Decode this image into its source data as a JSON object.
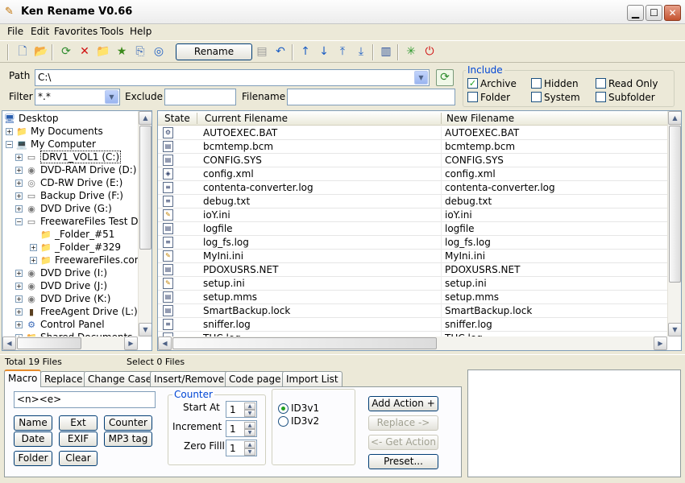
{
  "window": {
    "title": "Ken Rename V0.66",
    "icon": "pencil-icon"
  },
  "menu": [
    "File",
    "Edit",
    "Favorites",
    "Tools",
    "Help"
  ],
  "toolbar": {
    "rename_label": "Rename",
    "icons": [
      "new-icon",
      "open-folder-icon",
      "refresh-icon",
      "delete-icon",
      "folder-icon",
      "favorites-star-icon",
      "copy-icon",
      "stop-icon",
      "rename-icon",
      "properties-icon",
      "undo-icon",
      "move-up-icon",
      "move-down-icon",
      "move-top-icon",
      "move-bottom-icon",
      "options-icon",
      "grid-icon",
      "power-icon"
    ]
  },
  "path": {
    "label": "Path",
    "value": "C:\\"
  },
  "filter": {
    "label": "Filter",
    "value": "*.*"
  },
  "exclude": {
    "label": "Exclude",
    "value": ""
  },
  "filename": {
    "label": "Filename",
    "value": ""
  },
  "include": {
    "title": "Include",
    "options": [
      {
        "label": "Archive",
        "checked": true
      },
      {
        "label": "Hidden",
        "checked": false
      },
      {
        "label": "Read Only",
        "checked": false
      },
      {
        "label": "Folder",
        "checked": false
      },
      {
        "label": "System",
        "checked": false
      },
      {
        "label": "Subfolder",
        "checked": false
      }
    ]
  },
  "tree": [
    {
      "label": "Desktop",
      "icon": "desktop-icon",
      "level": 0,
      "expander": ""
    },
    {
      "label": "My Documents",
      "icon": "documents-icon",
      "level": 1,
      "expander": "+"
    },
    {
      "label": "My Computer",
      "icon": "computer-icon",
      "level": 1,
      "expander": "-"
    },
    {
      "label": "DRV1_VOL1 (C:)",
      "icon": "drive-icon",
      "level": 2,
      "expander": "+",
      "selected": true
    },
    {
      "label": "DVD-RAM Drive (D:)",
      "icon": "dvd-drive-icon",
      "level": 2,
      "expander": "+"
    },
    {
      "label": "CD-RW Drive (E:)",
      "icon": "cd-drive-icon",
      "level": 2,
      "expander": "+"
    },
    {
      "label": "Backup Drive (F:)",
      "icon": "drive-icon",
      "level": 2,
      "expander": "+"
    },
    {
      "label": "DVD Drive (G:)",
      "icon": "dvd-drive-icon",
      "level": 2,
      "expander": "+"
    },
    {
      "label": "FreewareFiles Test Dr",
      "icon": "drive-icon",
      "level": 2,
      "expander": "-"
    },
    {
      "label": "_Folder_#51",
      "icon": "folder-icon",
      "level": 3,
      "expander": ""
    },
    {
      "label": "_Folder_#329",
      "icon": "folder-icon",
      "level": 3,
      "expander": "+"
    },
    {
      "label": "FreewareFiles.com",
      "icon": "folder-icon",
      "level": 3,
      "expander": "+"
    },
    {
      "label": "DVD Drive (I:)",
      "icon": "dvd-drive-icon",
      "level": 2,
      "expander": "+"
    },
    {
      "label": "DVD Drive (J:)",
      "icon": "dvd-drive-icon",
      "level": 2,
      "expander": "+"
    },
    {
      "label": "DVD Drive (K:)",
      "icon": "dvd-drive-icon",
      "level": 2,
      "expander": "+"
    },
    {
      "label": "FreeAgent Drive (L:)",
      "icon": "external-drive-icon",
      "level": 2,
      "expander": "+"
    },
    {
      "label": "Control Panel",
      "icon": "control-panel-icon",
      "level": 2,
      "expander": "+"
    },
    {
      "label": "Shared Documents",
      "icon": "folder-icon",
      "level": 2,
      "expander": "+"
    }
  ],
  "file_list": {
    "columns": [
      "State",
      "Current Filename",
      "New Filename"
    ],
    "rows": [
      {
        "current": "AUTOEXEC.BAT",
        "new": "AUTOEXEC.BAT",
        "icon": "batch-file-icon"
      },
      {
        "current": "bcmtemp.bcm",
        "new": "bcmtemp.bcm",
        "icon": "file-icon"
      },
      {
        "current": "CONFIG.SYS",
        "new": "CONFIG.SYS",
        "icon": "system-file-icon"
      },
      {
        "current": "config.xml",
        "new": "config.xml",
        "icon": "xml-file-icon"
      },
      {
        "current": "contenta-converter.log",
        "new": "contenta-converter.log",
        "icon": "text-file-icon"
      },
      {
        "current": "debug.txt",
        "new": "debug.txt",
        "icon": "text-file-icon"
      },
      {
        "current": "ioY.ini",
        "new": "ioY.ini",
        "icon": "ini-file-icon"
      },
      {
        "current": "logfile",
        "new": "logfile",
        "icon": "file-icon"
      },
      {
        "current": "log_fs.log",
        "new": "log_fs.log",
        "icon": "text-file-icon"
      },
      {
        "current": "MyIni.ini",
        "new": "MyIni.ini",
        "icon": "ini-file-icon"
      },
      {
        "current": "PDOXUSRS.NET",
        "new": "PDOXUSRS.NET",
        "icon": "file-icon"
      },
      {
        "current": "setup.ini",
        "new": "setup.ini",
        "icon": "ini-file-icon"
      },
      {
        "current": "setup.mms",
        "new": "setup.mms",
        "icon": "file-icon"
      },
      {
        "current": "SmartBackup.lock",
        "new": "SmartBackup.lock",
        "icon": "file-icon"
      },
      {
        "current": "sniffer.log",
        "new": "sniffer.log",
        "icon": "text-file-icon"
      },
      {
        "current": "THC.log",
        "new": "THC.log",
        "icon": "text-file-icon"
      }
    ]
  },
  "status": {
    "total": "Total 19 Files",
    "selected": "Select 0 Files"
  },
  "tabs": [
    "Macro",
    "Replace",
    "Change Case",
    "Insert/Remove",
    "Code page",
    "Import List"
  ],
  "macro": {
    "value": "<n><e>",
    "buttons": [
      "Name",
      "Ext",
      "Counter",
      "Date",
      "EXIF",
      "MP3 tag",
      "Folder",
      "Clear"
    ],
    "counter": {
      "title": "Counter",
      "start_label": "Start At",
      "start_value": "1",
      "increment_label": "Increment",
      "increment_value": "1",
      "zero_label": "Zero Filll",
      "zero_value": "1"
    },
    "id3": [
      {
        "label": "ID3v1",
        "checked": true
      },
      {
        "label": "ID3v2",
        "checked": false
      }
    ],
    "actions": {
      "add": "Add Action +",
      "replace": "Replace ->",
      "get": "<- Get Action",
      "preset": "Preset..."
    }
  },
  "colors": {
    "accent": "#0046d5",
    "tab_highlight": "#e68b2c",
    "window_bg": "#ece9d8"
  }
}
